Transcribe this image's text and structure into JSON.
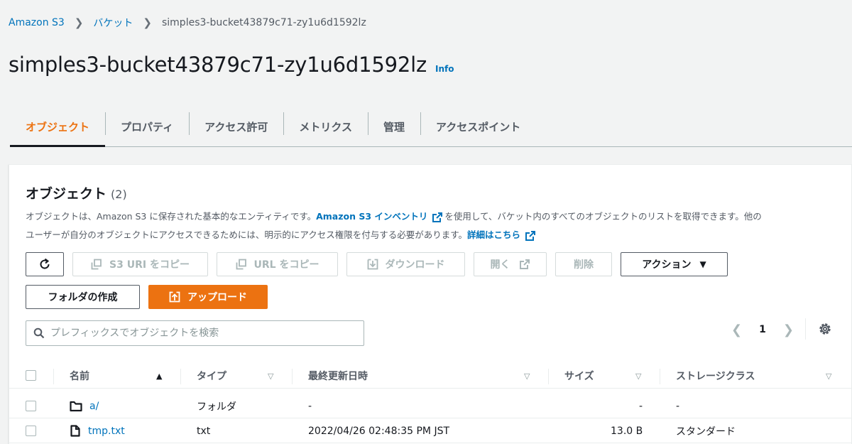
{
  "breadcrumb": {
    "items": [
      {
        "label": "Amazon S3"
      },
      {
        "label": "バケット"
      }
    ],
    "current": "simples3-bucket43879c71-zy1u6d1592lz"
  },
  "page": {
    "title": "simples3-bucket43879c71-zy1u6d1592lz",
    "info_label": "Info"
  },
  "tabs": [
    {
      "label": "オブジェクト",
      "active": true
    },
    {
      "label": "プロパティ"
    },
    {
      "label": "アクセス許可"
    },
    {
      "label": "メトリクス"
    },
    {
      "label": "管理"
    },
    {
      "label": "アクセスポイント"
    }
  ],
  "objects_panel": {
    "title": "オブジェクト",
    "count": "(2)",
    "desc_part1": "オブジェクトは、Amazon S3 に保存された基本的なエンティティです。",
    "desc_link1": "Amazon S3 インベントリ",
    "desc_part2": "を使用して、バケット内のすべてのオブジェクトのリストを取得できます。他の",
    "desc_part3": "ユーザーが自分のオブジェクトにアクセスできるためには、明示的にアクセス権限を付与する必要があります。",
    "desc_link2": "詳細はこちら"
  },
  "toolbar": {
    "copy_s3_uri": "S3 URI をコピー",
    "copy_url": "URL をコピー",
    "download": "ダウンロード",
    "open": "開く",
    "delete": "削除",
    "actions": "アクション",
    "create_folder": "フォルダの作成",
    "upload": "アップロード"
  },
  "search": {
    "placeholder": "プレフィックスでオブジェクトを検索",
    "value": ""
  },
  "pagination": {
    "current_page": "1"
  },
  "table": {
    "columns": [
      "名前",
      "タイプ",
      "最終更新日時",
      "サイズ",
      "ストレージクラス"
    ],
    "rows": [
      {
        "name": "a/",
        "icon": "folder-icon",
        "type": "フォルダ",
        "modified": "-",
        "size": "-",
        "storage_class": "-"
      },
      {
        "name": "tmp.txt",
        "icon": "file-icon",
        "type": "txt",
        "modified": "2022/04/26 02:48:35 PM JST",
        "size": "13.0 B",
        "storage_class": "スタンダード"
      }
    ]
  },
  "colors": {
    "accent": "#ec7211",
    "link": "#0073bb",
    "text": "#16191f",
    "muted": "#545b64"
  }
}
